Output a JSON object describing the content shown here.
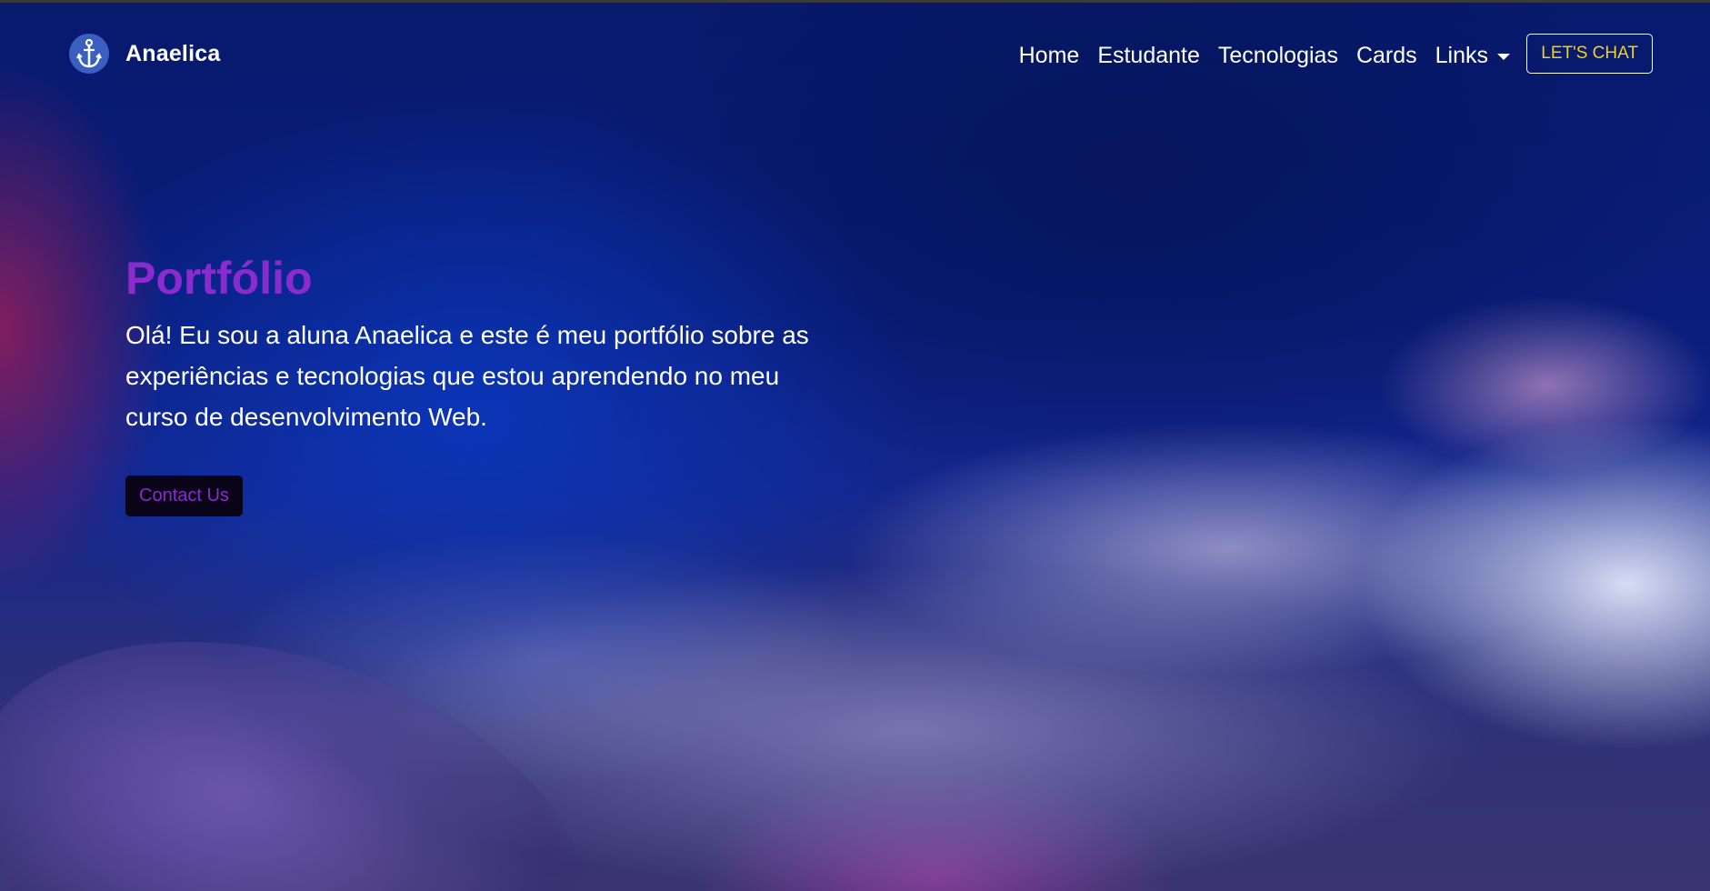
{
  "navbar": {
    "brand": {
      "name": "Anaelica",
      "logo_icon": "anchor-icon",
      "logo_bg_color": "#3b5fc0"
    },
    "links": [
      {
        "label": "Home"
      },
      {
        "label": "Estudante"
      },
      {
        "label": "Tecnologias"
      },
      {
        "label": "Cards"
      },
      {
        "label": "Links",
        "has_dropdown": true
      }
    ],
    "cta_label": "LET'S CHAT",
    "cta_text_color": "#f2d022"
  },
  "hero": {
    "title": "Portfólio",
    "title_color": "#8a2bd0",
    "description": "Olá! Eu sou a aluna Anaelica e este é meu portfólio sobre as experiências e tecnologias que estou aprendendo no meu curso de desenvolvimento Web.",
    "button_label": "Contact Us",
    "button_bg_color": "#0a0418"
  }
}
